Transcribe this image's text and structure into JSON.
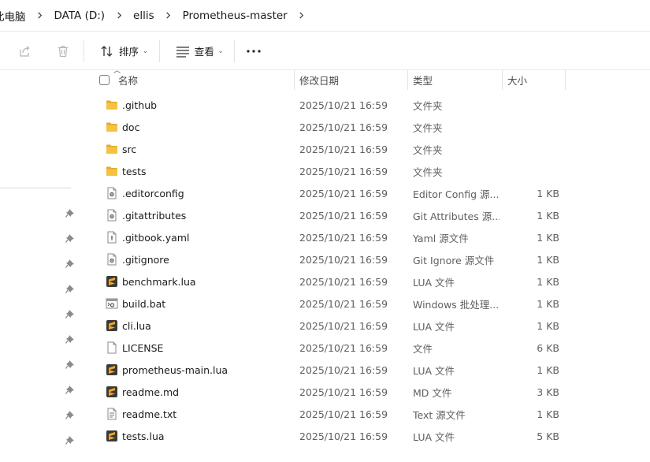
{
  "breadcrumb": [
    "此电脑",
    "DATA (D:)",
    "ellis",
    "Prometheus-master"
  ],
  "toolbar": {
    "sort_label": "排序",
    "view_label": "查看"
  },
  "columns": {
    "name": "名称",
    "modified": "修改日期",
    "type": "类型",
    "size": "大小"
  },
  "files": [
    {
      "name": ".github",
      "modified": "2025/10/21 16:59",
      "type": "文件夹",
      "size": "",
      "icon": "folder-icon"
    },
    {
      "name": "doc",
      "modified": "2025/10/21 16:59",
      "type": "文件夹",
      "size": "",
      "icon": "folder-icon"
    },
    {
      "name": "src",
      "modified": "2025/10/21 16:59",
      "type": "文件夹",
      "size": "",
      "icon": "folder-icon"
    },
    {
      "name": "tests",
      "modified": "2025/10/21 16:59",
      "type": "文件夹",
      "size": "",
      "icon": "folder-icon"
    },
    {
      "name": ".editorconfig",
      "modified": "2025/10/21 16:59",
      "type": "Editor Config 源...",
      "size": "1 KB",
      "icon": "config-file-icon"
    },
    {
      "name": ".gitattributes",
      "modified": "2025/10/21 16:59",
      "type": "Git Attributes 源...",
      "size": "1 KB",
      "icon": "config-file-icon"
    },
    {
      "name": ".gitbook.yaml",
      "modified": "2025/10/21 16:59",
      "type": "Yaml 源文件",
      "size": "1 KB",
      "icon": "yaml-file-icon"
    },
    {
      "name": ".gitignore",
      "modified": "2025/10/21 16:59",
      "type": "Git Ignore 源文件",
      "size": "1 KB",
      "icon": "config-file-icon"
    },
    {
      "name": "benchmark.lua",
      "modified": "2025/10/21 16:59",
      "type": "LUA 文件",
      "size": "1 KB",
      "icon": "sublime-file-icon"
    },
    {
      "name": "build.bat",
      "modified": "2025/10/21 16:59",
      "type": "Windows 批处理...",
      "size": "1 KB",
      "icon": "batch-file-icon"
    },
    {
      "name": "cli.lua",
      "modified": "2025/10/21 16:59",
      "type": "LUA 文件",
      "size": "1 KB",
      "icon": "sublime-file-icon"
    },
    {
      "name": "LICENSE",
      "modified": "2025/10/21 16:59",
      "type": "文件",
      "size": "6 KB",
      "icon": "blank-file-icon"
    },
    {
      "name": "prometheus-main.lua",
      "modified": "2025/10/21 16:59",
      "type": "LUA 文件",
      "size": "1 KB",
      "icon": "sublime-file-icon"
    },
    {
      "name": "readme.md",
      "modified": "2025/10/21 16:59",
      "type": "MD 文件",
      "size": "3 KB",
      "icon": "sublime-file-icon"
    },
    {
      "name": "readme.txt",
      "modified": "2025/10/21 16:59",
      "type": "Text 源文件",
      "size": "1 KB",
      "icon": "text-file-icon"
    },
    {
      "name": "tests.lua",
      "modified": "2025/10/21 16:59",
      "type": "LUA 文件",
      "size": "5 KB",
      "icon": "sublime-file-icon"
    }
  ],
  "colors": {
    "folder": "#f5c242",
    "folder_dark": "#e8a92a",
    "sublime": "#f5a623",
    "sublime_dark": "#3a3a3a"
  }
}
